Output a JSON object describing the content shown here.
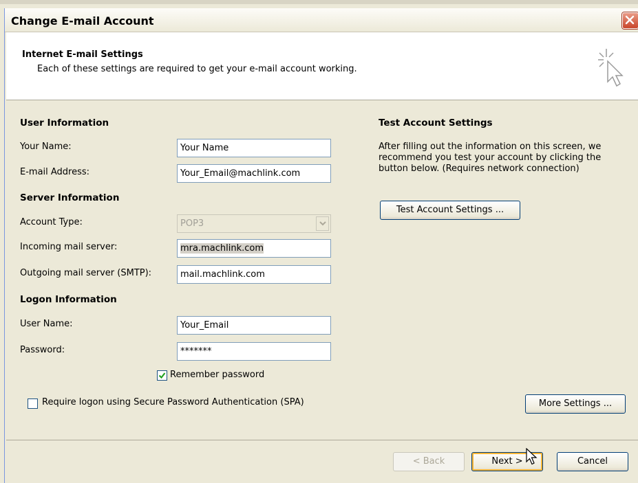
{
  "window": {
    "title": "Change E-mail Account"
  },
  "header": {
    "title": "Internet E-mail Settings",
    "description": "Each of these settings are required to get your e-mail account working."
  },
  "user_info": {
    "heading": "User Information",
    "name_label": "Your Name:",
    "name_value": "Your Name",
    "email_label": "E-mail Address:",
    "email_value": "Your_Email@machlink.com"
  },
  "server_info": {
    "heading": "Server Information",
    "account_type_label": "Account Type:",
    "account_type_value": "POP3",
    "incoming_label": "Incoming mail server:",
    "incoming_value": "mra.machlink.com",
    "outgoing_label": "Outgoing mail server (SMTP):",
    "outgoing_value": "mail.machlink.com"
  },
  "logon_info": {
    "heading": "Logon Information",
    "username_label": "User Name:",
    "username_value": "Your_Email",
    "password_label": "Password:",
    "password_value": "*******",
    "remember_label": "Remember password",
    "remember_checked": true,
    "spa_label": "Require logon using Secure Password Authentication (SPA)",
    "spa_checked": false
  },
  "test_settings": {
    "heading": "Test Account Settings",
    "desc_line1": "After filling out the information on this screen, we",
    "desc_line2": "recommend you test your account by clicking the",
    "desc_line3": "button below. (Requires network connection)",
    "button": "Test Account Settings ..."
  },
  "buttons": {
    "more_settings": "More Settings ...",
    "back": "< Back",
    "next": "Next >",
    "cancel": "Cancel"
  },
  "icons": {
    "close": "close-icon",
    "header": "sparkle-cursor-icon",
    "dropdown": "chevron-down-icon",
    "check": "checkmark-icon",
    "pointer": "mouse-pointer-icon"
  },
  "colors": {
    "dialog_bg": "#ece9d8",
    "close_button": "#c8452a",
    "button_border": "#003c74",
    "focus_ring": "#f8b636",
    "field_border": "#7f9db9"
  }
}
